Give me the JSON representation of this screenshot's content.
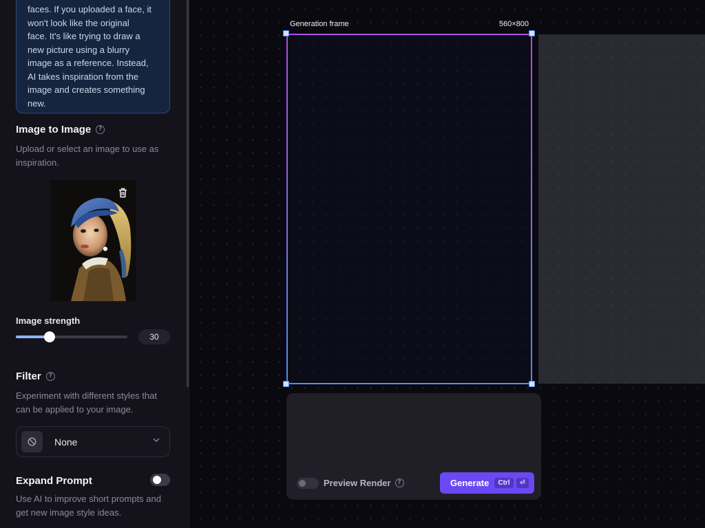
{
  "sidebar": {
    "info_box": {
      "lines": [
        "faces. If you uploaded a face, it",
        "won't look like the original",
        "face. It's like trying to draw a",
        "new picture using a blurry",
        "image as a reference. Instead,",
        "AI takes inspiration from the",
        "image and creates something",
        "new."
      ]
    },
    "image_to_image": {
      "title": "Image to Image",
      "description": "Upload or select an image to use as inspiration."
    },
    "image_strength": {
      "label": "Image strength",
      "value": "30",
      "fraction": 0.3
    },
    "filter": {
      "title": "Filter",
      "description": "Experiment with different styles that can be applied to your image.",
      "selected": "None"
    },
    "expand_prompt": {
      "title": "Expand Prompt",
      "description": "Use AI to improve short prompts and get new image style ideas.",
      "enabled": true
    }
  },
  "canvas": {
    "frame_label": "Generation frame",
    "frame_size": "560×800"
  },
  "prompt_panel": {
    "preview_render_label": "Preview Render",
    "preview_render_enabled": false,
    "generate_label": "Generate",
    "shortcut_keys": [
      "Ctrl",
      "⏎"
    ]
  },
  "icons": {
    "help": "question-circle-icon",
    "delete": "trash-icon",
    "filter": "no-filter-icon",
    "chevron": "chevron-down-icon"
  },
  "colors": {
    "accent": "#6a49f5",
    "frame_gradient_top": "#b04be8",
    "frame_gradient_bottom": "#4f8ff3",
    "slider_fill": "#8fb3ff"
  }
}
